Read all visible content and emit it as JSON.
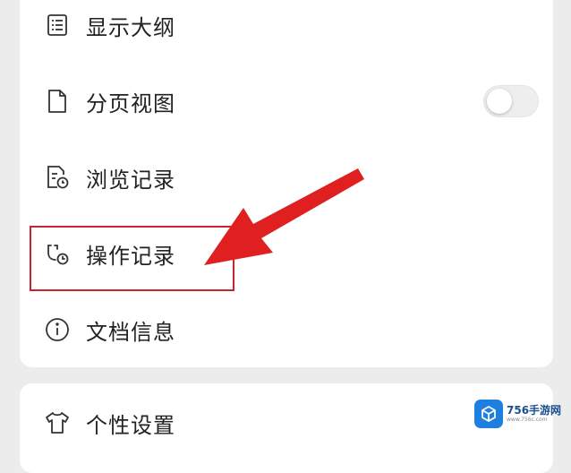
{
  "menu": {
    "items": [
      {
        "label": "显示大纲",
        "icon": "outline-list-icon"
      },
      {
        "label": "分页视图",
        "icon": "page-icon",
        "toggle_on": false
      },
      {
        "label": "浏览记录",
        "icon": "browse-history-icon"
      },
      {
        "label": "操作记录",
        "icon": "operation-history-icon"
      },
      {
        "label": "文档信息",
        "icon": "info-circle-icon"
      }
    ]
  },
  "settings": {
    "label": "个性设置",
    "icon": "tshirt-icon"
  },
  "annotation": {
    "arrow_color": "#e02020",
    "box_color": "#c8242c"
  },
  "watermark": {
    "brand": "756手游网",
    "url": "www.756c.com",
    "logo_color": "#1e7fe0"
  }
}
